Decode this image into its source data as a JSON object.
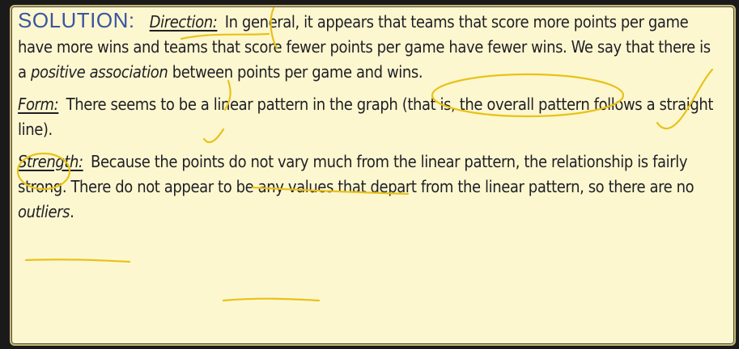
{
  "solution": {
    "heading": "SOLUTION:",
    "direction": {
      "label": "Direction:",
      "text_1": " In general, it appears that teams that score more points per game have more wins and teams that score fewer points per game have fewer wins. We say that there is a ",
      "term": "positive association",
      "text_2": " between points per game and wins."
    },
    "form": {
      "label": "Form:",
      "text": " There seems to be a linear pattern in the graph (that is, the overall pattern follows a straight line)."
    },
    "strength": {
      "label": "Strength:",
      "text_1": " Because the points do not vary much from the linear pattern, the relationship is fairly strong. There do not appear to be any values that depart from the linear pattern, so there are no ",
      "term": "outliers",
      "text_2": "."
    }
  },
  "colors": {
    "panel_bg": "#fdf7d0",
    "heading": "#3a55a0",
    "text": "#1f1f24",
    "annotation_ink": "#e8c21a"
  }
}
